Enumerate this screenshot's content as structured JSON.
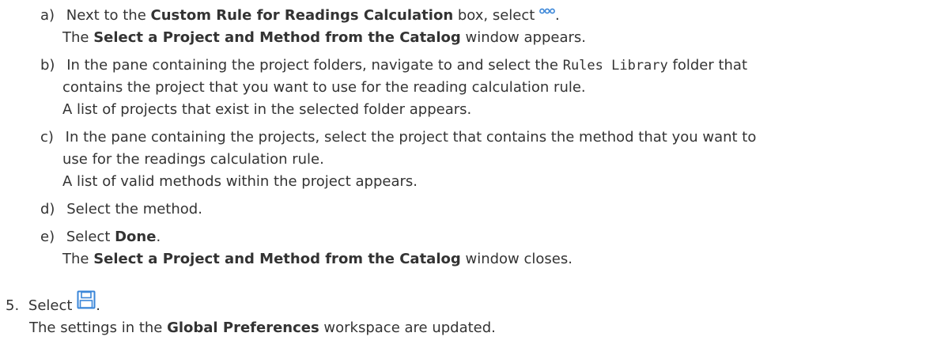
{
  "steps": {
    "a": {
      "marker": "a)",
      "line1_pre": "Next to the ",
      "line1_bold": "Custom Rule for Readings Calculation",
      "line1_post": " box, select ",
      "line1_end": ".",
      "icon": "ellipsis-icon",
      "result_pre": "The ",
      "result_bold": "Select a Project and Method from the Catalog",
      "result_post": " window appears."
    },
    "b": {
      "marker": "b)",
      "line1_pre": "In the pane containing the project folders, navigate to and select the ",
      "line1_code": "Rules Library",
      "line1_post": " folder that",
      "line2": "contains the project that you want to use for the reading calculation rule.",
      "result": "A list of projects that exist in the selected folder appears."
    },
    "c": {
      "marker": "c)",
      "line1": "In the pane containing the projects, select the project that contains the method that you want to",
      "line2": "use for the readings calculation rule.",
      "result": "A list of valid methods within the project appears."
    },
    "d": {
      "marker": "d)",
      "text": "Select the method."
    },
    "e": {
      "marker": "e)",
      "pre": "Select ",
      "bold": "Done",
      "post": ".",
      "result_pre": "The ",
      "result_bold": "Select a Project and Method from the Catalog",
      "result_post": " window closes."
    }
  },
  "step5": {
    "marker": "5.",
    "pre": "Select ",
    "post": ".",
    "icon": "save-icon",
    "result_pre": "The settings in the ",
    "result_bold": "Global Preferences",
    "result_post": " workspace are updated."
  }
}
